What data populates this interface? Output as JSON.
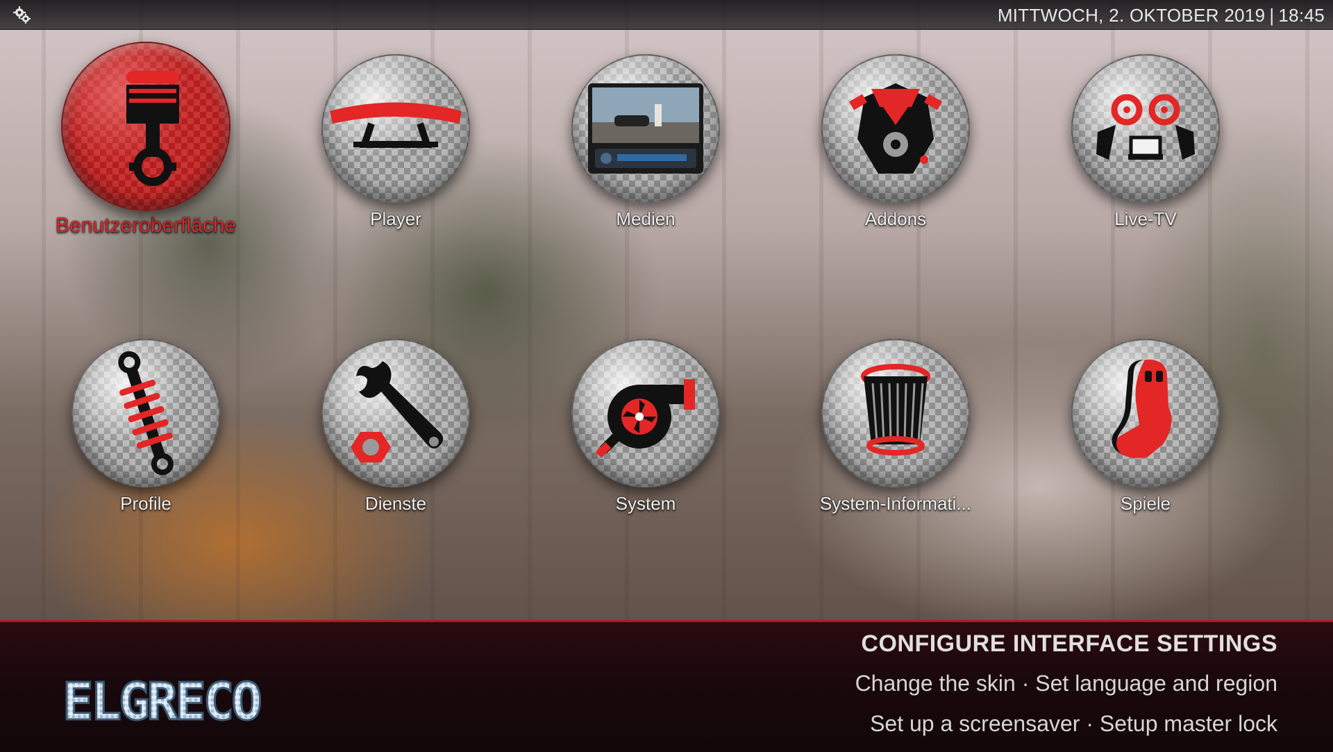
{
  "topbar": {
    "settings_icon": "settings-gear-icon",
    "date": "MITTWOCH, 2. OKTOBER 2019",
    "separator": "|",
    "time": "18:45"
  },
  "menu": {
    "items": [
      {
        "label": "Benutzeroberfläche",
        "icon": "piston-icon",
        "selected": true
      },
      {
        "label": "Player",
        "icon": "spoiler-icon",
        "selected": false
      },
      {
        "label": "Medien",
        "icon": "car-stereo-icon",
        "selected": false
      },
      {
        "label": "Addons",
        "icon": "engine-icon",
        "selected": false
      },
      {
        "label": "Live-TV",
        "icon": "speakers-icon",
        "selected": false
      },
      {
        "label": "Profile",
        "icon": "shock-absorber-icon",
        "selected": false
      },
      {
        "label": "Dienste",
        "icon": "wrench-nut-icon",
        "selected": false
      },
      {
        "label": "System",
        "icon": "turbo-icon",
        "selected": false
      },
      {
        "label": "System-Informati...",
        "icon": "air-filter-icon",
        "selected": false
      },
      {
        "label": "Spiele",
        "icon": "racing-seat-icon",
        "selected": false
      }
    ]
  },
  "info": {
    "title": "CONFIGURE INTERFACE SETTINGS",
    "line1": "Change the skin · Set language and region",
    "line2": "Set up a screensaver · Setup master lock"
  },
  "brand": {
    "logo_text": "ELGRECO"
  },
  "colors": {
    "accent": "#d8262b",
    "bottom_panel": "#1b090c",
    "label": "#f2f2f2"
  }
}
